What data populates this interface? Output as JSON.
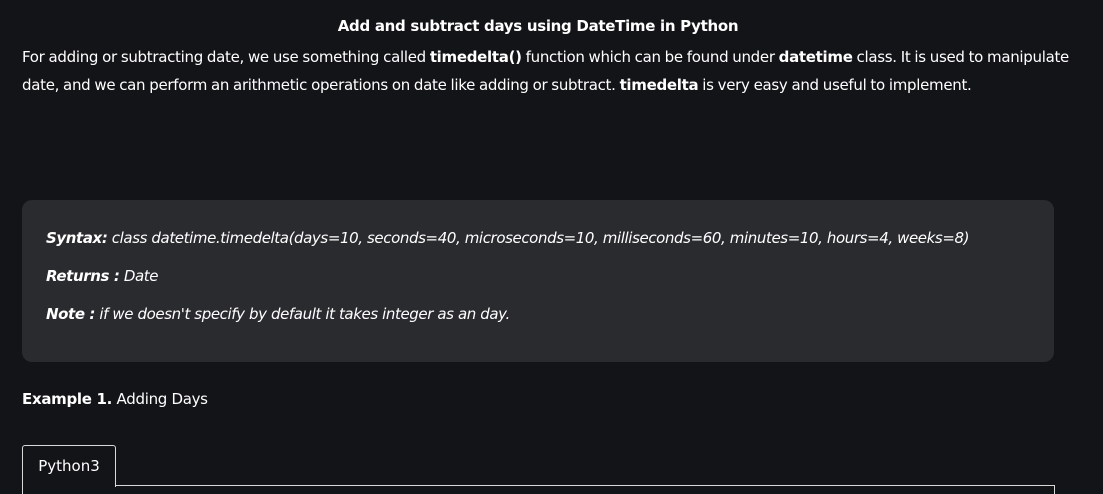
{
  "article": {
    "title": "Add and subtract days using DateTime in Python",
    "intro": {
      "part1": "For adding or subtracting date, we use something called ",
      "kw1": "timedelta()",
      "part2": " function which can be found under ",
      "kw2": "datetime",
      "part3": " class.  It is used to manipulate date, and we can perform an arithmetic operations on date like adding or subtract. ",
      "kw3": "timedelta",
      "part4": " is very easy and useful to implement."
    }
  },
  "syntax_box": {
    "syntax_label": "Syntax:",
    "syntax_text": " class datetime.timedelta(days=10, seconds=40, microseconds=10, milliseconds=60, minutes=10, hours=4, weeks=8)",
    "returns_label": "Returns :",
    "returns_text": " Date",
    "note_label": "Note :",
    "note_text": " if we doesn't specify by default it takes integer as an day."
  },
  "example": {
    "label": "Example 1.",
    "text": " Adding Days"
  },
  "code_tabs": [
    {
      "label": "Python3"
    }
  ]
}
